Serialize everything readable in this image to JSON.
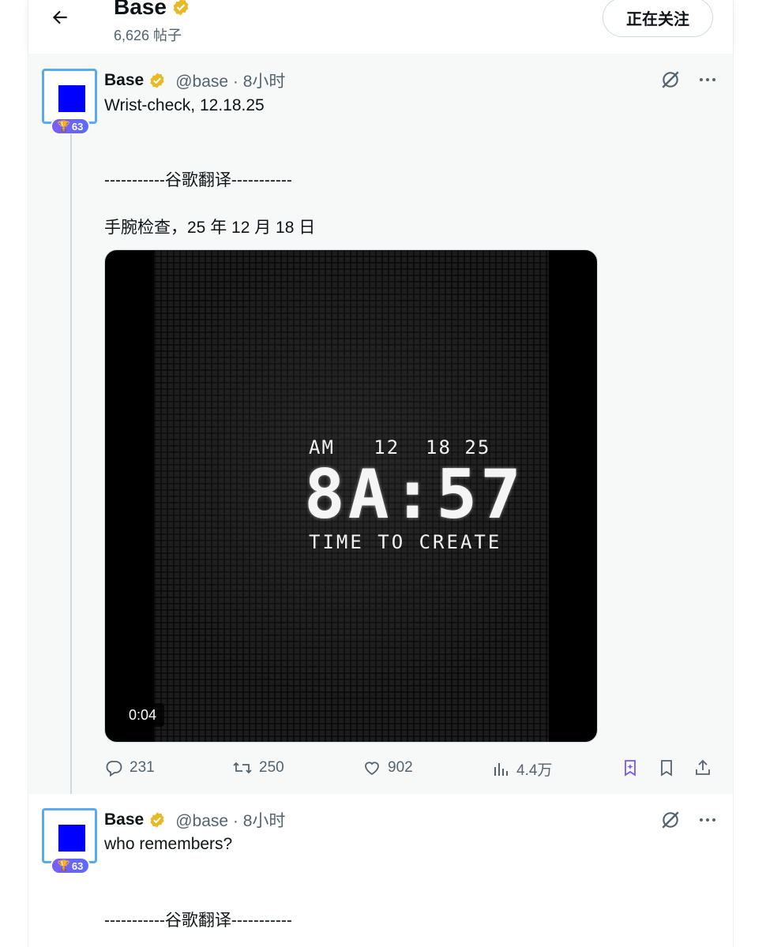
{
  "header": {
    "title": "Base",
    "post_count": "6,626 帖子",
    "follow_button": "正在关注"
  },
  "posts": [
    {
      "name": "Base",
      "handle": "@base · 8小时",
      "badge": "63",
      "text_lines": [
        "Wrist-check, 12.18.25",
        "-----------谷歌翻译-----------",
        "手腕检查，25 年 12 月 18 日"
      ],
      "media": {
        "date_line": "AM   12  18 25",
        "time": "8A:57",
        "caption": "TIME TO CREATE",
        "duration": "0:04"
      },
      "stats": {
        "replies": "231",
        "reposts": "250",
        "likes": "902",
        "views": "4.4万"
      }
    },
    {
      "name": "Base",
      "handle": "@base · 8小时",
      "badge": "63",
      "text_lines": [
        "who remembers?",
        "-----------谷歌翻译-----------"
      ]
    }
  ],
  "colors": {
    "accent": "#1d9bf0",
    "verified": "#e8b923",
    "grok": "#7856ff",
    "avatar": "#0000ff"
  },
  "icons": [
    "back-arrow-icon",
    "verified-badge-icon",
    "trophy-icon",
    "grok-icon",
    "more-icon",
    "reply-icon",
    "repost-icon",
    "like-icon",
    "views-icon",
    "grok-bookmark-icon",
    "bookmark-icon",
    "share-icon"
  ]
}
